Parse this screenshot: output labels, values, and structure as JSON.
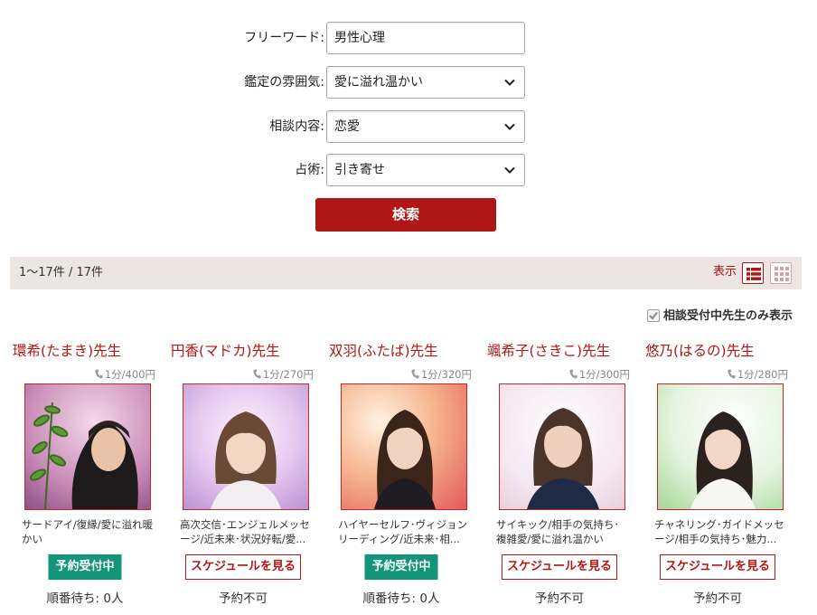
{
  "search_form": {
    "freeword": {
      "label": "フリーワード:",
      "value": "男性心理"
    },
    "atmosphere": {
      "label": "鑑定の雰囲気:",
      "selected": "愛に溢れ温かい"
    },
    "topic": {
      "label": "相談内容:",
      "selected": "恋愛"
    },
    "method": {
      "label": "占術:",
      "selected": "引き寄せ"
    },
    "submit_label": "検索"
  },
  "results": {
    "count_text": "1〜17件 / 17件",
    "display_label": "表示",
    "view_modes": [
      "list-icon",
      "grid-icon"
    ],
    "active_view": "list"
  },
  "filter": {
    "label": "相談受付中先生のみ表示",
    "checked": true
  },
  "cards": [
    {
      "name": "環希(たまき)先生",
      "price": "1分/400円",
      "tags": "サードアイ/復縁/愛に溢れ暖かい",
      "status": "予約受付中",
      "status_type": "open",
      "wait": "順番待ち: 0人"
    },
    {
      "name": "円香(マドカ)先生",
      "price": "1分/270円",
      "tags": "高次交信･エンジェルメッセージ/近未来･状況好転/愛...",
      "status": "スケジュールを見る",
      "status_type": "schedule",
      "wait": "予約不可"
    },
    {
      "name": "双羽(ふたば)先生",
      "price": "1分/320円",
      "tags": "ハイヤーセルフ･ヴィジョンリーディング/近未来･相...",
      "status": "予約受付中",
      "status_type": "open",
      "wait": "順番待ち: 0人"
    },
    {
      "name": "颯希子(さきこ)先生",
      "price": "1分/300円",
      "tags": "サイキック/相手の気持ち･複雑愛/愛に溢れ温かい",
      "status": "スケジュールを見る",
      "status_type": "schedule",
      "wait": "予約不可"
    },
    {
      "name": "悠乃(はるの)先生",
      "price": "1分/280円",
      "tags": "チャネリング･ガイドメッセージ/相手の気持ち･魅力...",
      "status": "スケジュールを見る",
      "status_type": "schedule",
      "wait": "予約不可"
    }
  ],
  "colors": {
    "accent": "#b01616",
    "open_status": "#13957a",
    "bar_bg": "#ece5e2"
  }
}
